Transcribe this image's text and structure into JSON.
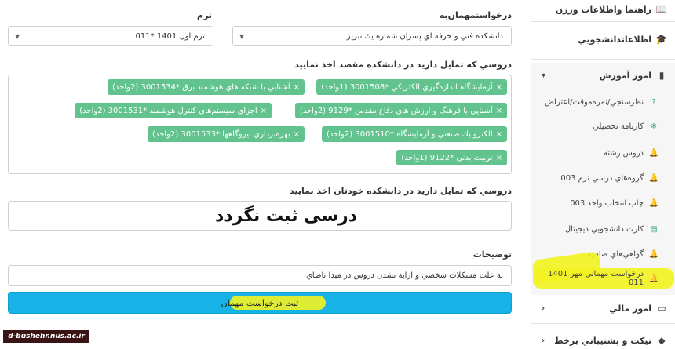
{
  "sidebar": {
    "top_item": "راهنما واطلاعات ورزن",
    "student_info": "اطلاعاتدانشجويي",
    "education": "امور آموزش",
    "education_items": [
      "نظرسنجي/نمره‌موقت/اعتراض",
      "كارنامه تحصيلي",
      "دروس رشته",
      "گروه‌هاي درسي ترم 003",
      "چاپ انتخاب واحد 003",
      "كارت دانشجويي ديجيتال",
      "گواهي‌هاي صادره",
      "درخواست مهماني مهر 1401 011"
    ],
    "finance": "امور مالي",
    "ticket": "تيكت و پشتيباني برخط"
  },
  "form": {
    "host_label": "درخواستمهمان‌به",
    "host_value": "دانشكده فني و حرفه اي پسران شماره يك تبريز",
    "term_label": "ترم",
    "term_value": "ترم اول 1401 *011",
    "dest_courses_label": "دروسي كه تمايل داريد در دانشكده مقصد اخذ نماييد",
    "dest_courses": [
      "آزمايشگاه اندازه‌گيري الكتريكي *3001508 (1واحد)",
      "آشنايي با شبكه هاي هوشمند برق *3001534 (2واحد)",
      "آشنايي با فرهنگ و ارزش هاي دفاع مقدس *9129 (2واحد)",
      "اجزاي سيستم‌هاي كنترل هوشمند *3001531 (2واحد)",
      "الكترونيك صنعتي و آزمايشگاه *3001510 (2واحد)",
      "بهره‌برداري نيروگاهها *3001533 (2واحد)",
      "تربيت بدني *9122 (1واحد)"
    ],
    "own_courses_label": "دروسي كه تمايل داريد در دانشكده خودتان اخذ نماييد",
    "own_courses_note": "درسی  ثبت نگردد",
    "desc_label": "توضيحات",
    "desc_value": "به علت مشكلات شخصي و ارايه نشدن دروس در مبدا تاضاي",
    "submit_label": "ثبت درخواست مهمان"
  },
  "watermark": "d-bushehr.nus.ac.ir",
  "colors": {
    "tag": "#62c38e",
    "submit": "#17b3e6",
    "highlight": "#f3f321"
  },
  "icons": [
    "book-icon",
    "graduation-cap-icon",
    "chevron-down-icon",
    "bell-icon",
    "snowflake-icon",
    "card-icon",
    "money-icon",
    "ticket-icon"
  ]
}
